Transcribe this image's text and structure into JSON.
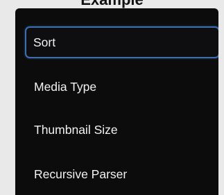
{
  "caption": "Example",
  "menu": {
    "items": [
      {
        "label": "Sort",
        "selected": true
      },
      {
        "label": "Media Type"
      },
      {
        "label": "Thumbnail Size"
      },
      {
        "label": "Recursive Parser"
      }
    ]
  },
  "colors": {
    "panel_background": "#0c0c0c",
    "text": "#f2f2f2",
    "focus_border": "#3d6fb0",
    "page_background": "#e9e9e9"
  }
}
